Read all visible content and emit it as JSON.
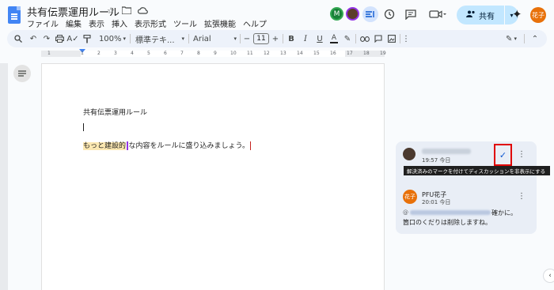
{
  "header": {
    "title": "共有伝票運用ルール",
    "menu": [
      "ファイル",
      "編集",
      "表示",
      "挿入",
      "表示形式",
      "ツール",
      "拡張機能",
      "ヘルプ"
    ],
    "presence": [
      "M",
      ""
    ],
    "share_label": "共有",
    "user_avatar": "花子"
  },
  "toolbar": {
    "zoom": "100%",
    "style": "標準テキ...",
    "font": "Arial",
    "font_size": "11"
  },
  "document": {
    "title": "共有伝票運用ルール",
    "line_highlight": "もっと建設的",
    "line_rest": "な内容をルールに盛り込みましょう。"
  },
  "comments": {
    "first": {
      "time": "19:57 今日",
      "tooltip": "解決済みのマークを付けてディスカッションを非表示にする"
    },
    "reply": {
      "avatar": "花子",
      "author": "PFU花子",
      "time": "20:01 今日",
      "mention_prefix": "@",
      "text_a": "確かに。",
      "text_b": "箇口のくだりは削除しますね。"
    }
  },
  "colors": {
    "accent": "#0b57d0",
    "share_bg": "#c2e7ff",
    "highlight": "#fce8b2",
    "annotation_box": "#e00000"
  }
}
